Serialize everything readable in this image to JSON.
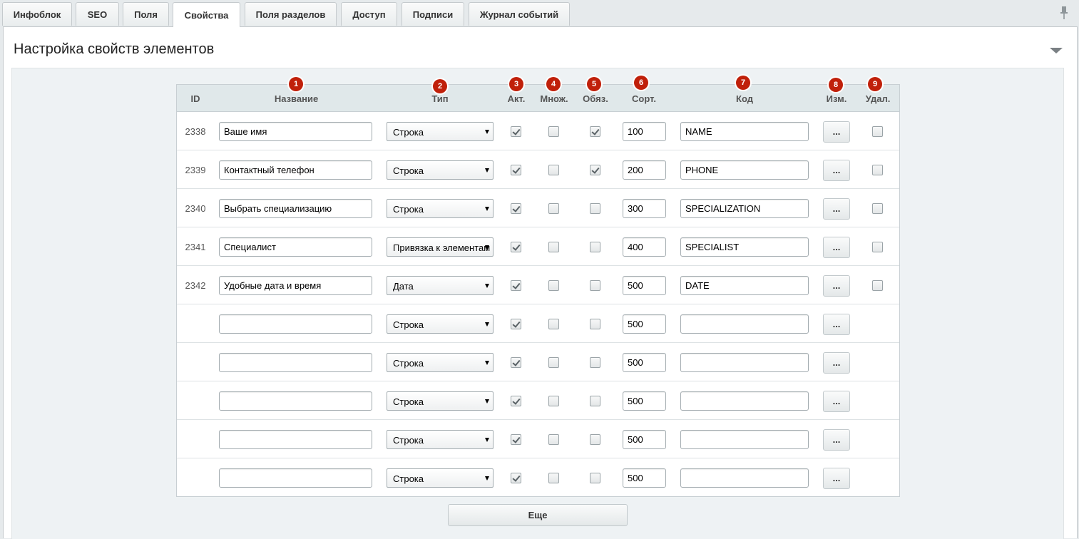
{
  "tabs": [
    {
      "label": "Инфоблок",
      "active": false
    },
    {
      "label": "SEO",
      "active": false
    },
    {
      "label": "Поля",
      "active": false
    },
    {
      "label": "Свойства",
      "active": true
    },
    {
      "label": "Поля разделов",
      "active": false
    },
    {
      "label": "Доступ",
      "active": false
    },
    {
      "label": "Подписи",
      "active": false
    },
    {
      "label": "Журнал событий",
      "active": false
    }
  ],
  "section": {
    "title": "Настройка свойств элементов"
  },
  "columns": {
    "id": "ID",
    "name": "Название",
    "type": "Тип",
    "active": "Акт.",
    "multiple": "Множ.",
    "required": "Обяз.",
    "sort": "Сорт.",
    "code": "Код",
    "edit": "Изм.",
    "delete": "Удал."
  },
  "badges": [
    "1",
    "2",
    "3",
    "4",
    "5",
    "6",
    "7",
    "8",
    "9"
  ],
  "rows": [
    {
      "id": "2338",
      "name": "Ваше имя",
      "type": "Строка",
      "active": true,
      "multiple": false,
      "required": true,
      "sort": "100",
      "code": "NAME",
      "edit_label": "...",
      "deletable": true
    },
    {
      "id": "2339",
      "name": "Контактный телефон",
      "type": "Строка",
      "active": true,
      "multiple": false,
      "required": true,
      "sort": "200",
      "code": "PHONE",
      "edit_label": "...",
      "deletable": true
    },
    {
      "id": "2340",
      "name": "Выбрать специализацию",
      "type": "Строка",
      "active": true,
      "multiple": false,
      "required": false,
      "sort": "300",
      "code": "SPECIALIZATION",
      "edit_label": "...",
      "deletable": true
    },
    {
      "id": "2341",
      "name": "Специалист",
      "type": "Привязка к элементам",
      "active": true,
      "multiple": false,
      "required": false,
      "sort": "400",
      "code": "SPECIALIST",
      "edit_label": "...",
      "deletable": true
    },
    {
      "id": "2342",
      "name": "Удобные дата и время",
      "type": "Дата",
      "active": true,
      "multiple": false,
      "required": false,
      "sort": "500",
      "code": "DATE",
      "edit_label": "...",
      "deletable": true
    },
    {
      "id": "",
      "name": "",
      "type": "Строка",
      "active": true,
      "multiple": false,
      "required": false,
      "sort": "500",
      "code": "",
      "edit_label": "...",
      "deletable": false
    },
    {
      "id": "",
      "name": "",
      "type": "Строка",
      "active": true,
      "multiple": false,
      "required": false,
      "sort": "500",
      "code": "",
      "edit_label": "...",
      "deletable": false
    },
    {
      "id": "",
      "name": "",
      "type": "Строка",
      "active": true,
      "multiple": false,
      "required": false,
      "sort": "500",
      "code": "",
      "edit_label": "...",
      "deletable": false
    },
    {
      "id": "",
      "name": "",
      "type": "Строка",
      "active": true,
      "multiple": false,
      "required": false,
      "sort": "500",
      "code": "",
      "edit_label": "...",
      "deletable": false
    },
    {
      "id": "",
      "name": "",
      "type": "Строка",
      "active": true,
      "multiple": false,
      "required": false,
      "sort": "500",
      "code": "",
      "edit_label": "...",
      "deletable": false
    }
  ],
  "more_button": "Еще"
}
